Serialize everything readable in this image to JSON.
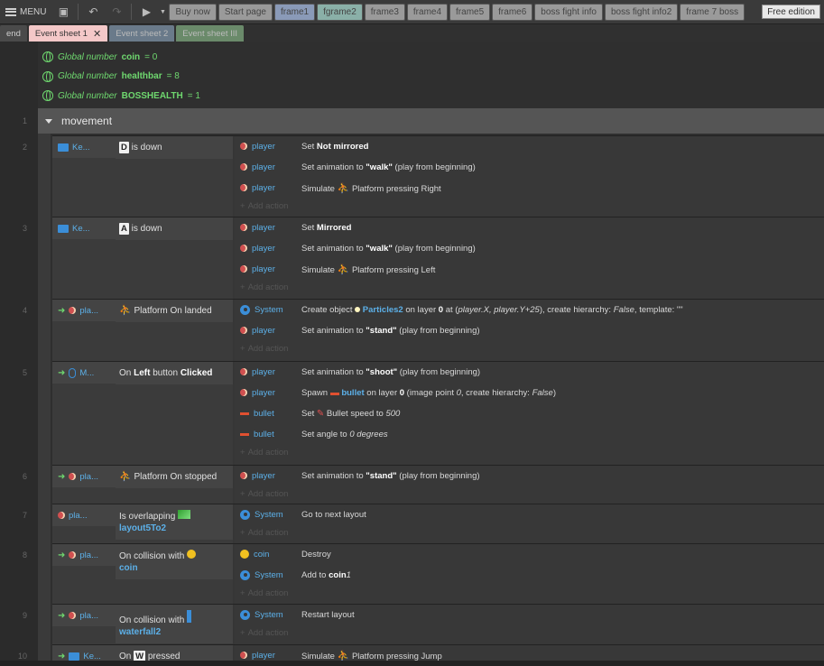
{
  "toolbar": {
    "menu_label": "MENU",
    "tabs": [
      {
        "label": "Buy now",
        "bg": "#9a9a9a"
      },
      {
        "label": "Start page",
        "bg": "#9a9a9a"
      },
      {
        "label": "frame1",
        "bg": "#8a9ab8"
      },
      {
        "label": "fgrame2",
        "bg": "#8ab0a8"
      },
      {
        "label": "frame3",
        "bg": "#9a9a9a"
      },
      {
        "label": "frame4",
        "bg": "#9a9a9a"
      },
      {
        "label": "frame5",
        "bg": "#9a9a9a"
      },
      {
        "label": "frame6",
        "bg": "#9a9a9a"
      },
      {
        "label": "boss fight info",
        "bg": "#9a9a9a"
      },
      {
        "label": "boss fight info2",
        "bg": "#9a9a9a"
      },
      {
        "label": "frame 7 boss",
        "bg": "#9a9a9a"
      }
    ],
    "free_edition": "Free edition"
  },
  "sheet_tabs": [
    {
      "label": "end",
      "bg": "#4a4a4a",
      "color": "#cfcfcf"
    },
    {
      "label": "Event sheet 1",
      "bg": "#f4c8c8",
      "color": "#333",
      "closable": true,
      "close": "✕"
    },
    {
      "label": "Event sheet 2",
      "bg": "#6a7a8a",
      "color": "#bbb"
    },
    {
      "label": "Event sheet III",
      "bg": "#6a8a6a",
      "color": "#bbb"
    }
  ],
  "globals": [
    {
      "prefix": "Global number",
      "name": "coin",
      "value": "= 0"
    },
    {
      "prefix": "Global number",
      "name": "healthbar",
      "value": "= 8"
    },
    {
      "prefix": "Global number",
      "name": "BOSSHEALTH",
      "value": "= 1"
    }
  ],
  "group": {
    "number": "1",
    "title": "movement"
  },
  "add_action": "Add action",
  "events": [
    {
      "number": "2",
      "cond_obj": "Ke...",
      "cond_key": "D",
      "cond_text": "is down",
      "actions": [
        {
          "obj": "player",
          "text_plain": "Set ",
          "text_bold": "Not mirrored"
        },
        {
          "obj": "player",
          "text_plain": "Set animation to ",
          "text_bold": "\"walk\"",
          "text_after": " (play from beginning)"
        },
        {
          "obj": "player",
          "text_plain": "Simulate ",
          "text_after": " Platform pressing Right"
        }
      ]
    },
    {
      "number": "3",
      "cond_obj": "Ke...",
      "cond_key": "A",
      "cond_text": "is down",
      "actions": [
        {
          "obj": "player",
          "text_plain": "Set ",
          "text_bold": "Mirrored"
        },
        {
          "obj": "player",
          "text_plain": "Set animation to ",
          "text_bold": "\"walk\"",
          "text_after": " (play from beginning)"
        },
        {
          "obj": "player",
          "text_plain": "Simulate ",
          "text_after": " Platform pressing Left"
        }
      ]
    },
    {
      "number": "4",
      "cond_obj": "pla...",
      "cond_text": "Platform On landed",
      "actions": [
        {
          "obj": "System",
          "text_plain": "Create object ",
          "text_blue": "Particles2",
          "text_mid": " on layer ",
          "text_bold": "0",
          "text_after": " at (",
          "text_italic": "player.X, player.Y+25",
          "text_tail": "), create hierarchy: ",
          "text_italic2": "False",
          "text_tail2": ", template: \"\""
        },
        {
          "obj": "player",
          "text_plain": "Set animation to ",
          "text_bold": "\"stand\"",
          "text_after": " (play from beginning)"
        }
      ]
    },
    {
      "number": "5",
      "cond_obj": "M...",
      "cond_text_a": "On ",
      "cond_text_b": "Left",
      "cond_text_c": " button ",
      "cond_text_d": "Clicked",
      "actions": [
        {
          "obj": "player",
          "text_plain": "Set animation to ",
          "text_bold": "\"shoot\"",
          "text_after": " (play from beginning)"
        },
        {
          "obj": "player",
          "text_plain": "Spawn ",
          "text_blue": "bullet",
          "text_mid": " on layer ",
          "text_bold": "0",
          "text_after": " (image point ",
          "text_italic": "0",
          "text_tail": ", create hierarchy: ",
          "text_italic2": "False",
          "text_tail2": ")"
        },
        {
          "obj": "bullet",
          "text_plain": "Set ",
          "text_after": " Bullet speed to ",
          "text_italic": "500"
        },
        {
          "obj": "bullet",
          "text_plain": "Set angle to ",
          "text_italic": "0 degrees"
        }
      ]
    },
    {
      "number": "6",
      "cond_obj": "pla...",
      "cond_text": "Platform On stopped",
      "actions": [
        {
          "obj": "player",
          "text_plain": "Set animation to ",
          "text_bold": "\"stand\"",
          "text_after": " (play from beginning)"
        }
      ]
    },
    {
      "number": "7",
      "cond_obj": "pla...",
      "cond_text": "Is overlapping",
      "cond_target": "layout5To2",
      "actions": [
        {
          "obj": "System",
          "text_plain": "Go to next layout"
        }
      ]
    },
    {
      "number": "8",
      "cond_obj": "pla...",
      "cond_text": "On collision with",
      "cond_target": "coin",
      "actions": [
        {
          "obj": "coin",
          "text_plain": "Destroy"
        },
        {
          "obj": "System",
          "text_plain": "Add ",
          "text_italic": "1",
          "text_mid": " to ",
          "text_bold": "coin"
        }
      ]
    },
    {
      "number": "9",
      "cond_obj": "pla...",
      "cond_text": "On collision with",
      "cond_target": "waterfall2",
      "actions": [
        {
          "obj": "System",
          "text_plain": "Restart layout"
        }
      ]
    },
    {
      "number": "10",
      "cond_obj": "Ke...",
      "cond_text_a": "On ",
      "cond_key": "W",
      "cond_text_c": " pressed",
      "actions": [
        {
          "obj": "player",
          "text_plain": "Simulate ",
          "text_after": " Platform pressing Jump"
        }
      ]
    }
  ]
}
